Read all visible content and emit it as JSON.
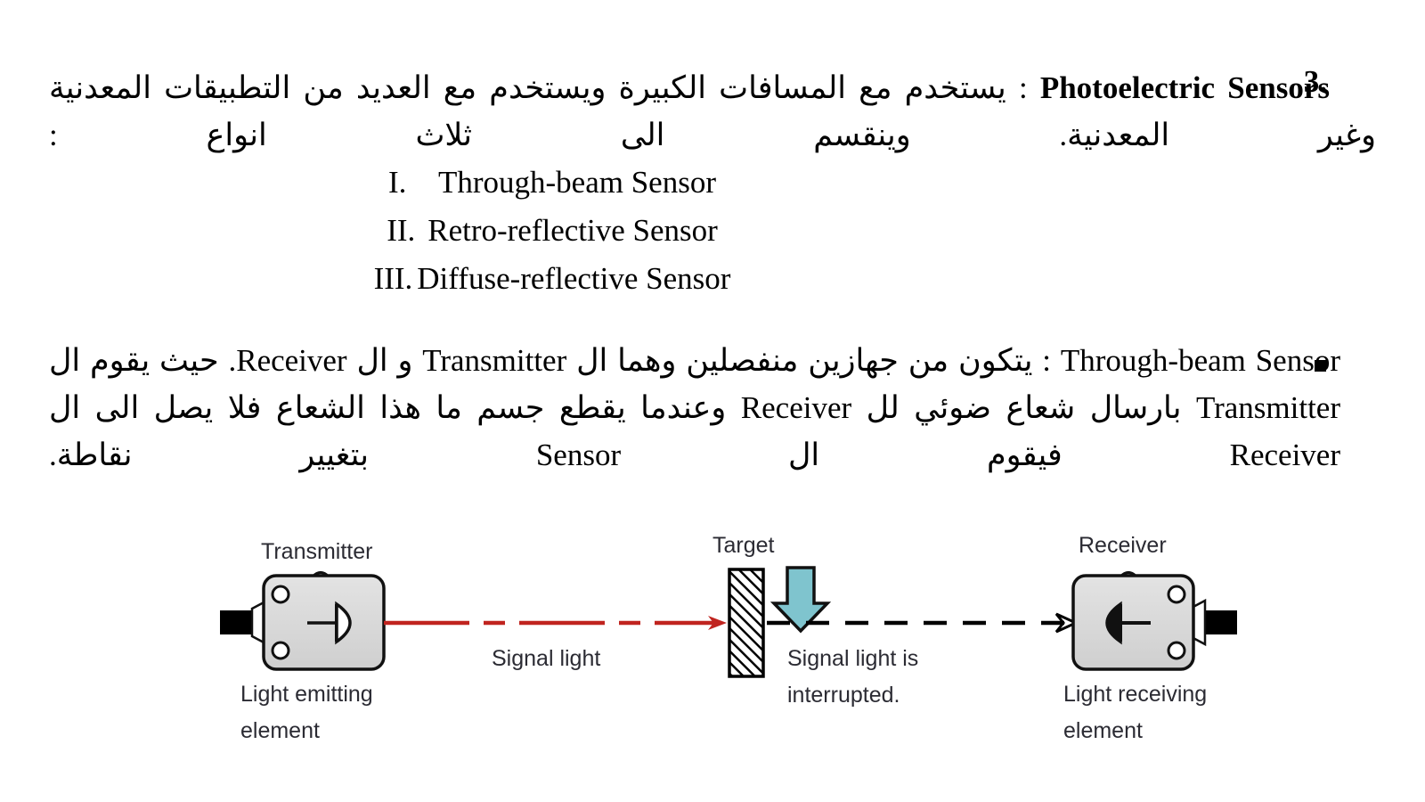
{
  "document": {
    "section_number": "3.",
    "section_title_en": "Photoelectric Sensors",
    "section_body_ar": " : يستخدم مع المسافات الكبيرة ويستخدم مع العديد من التطبيقات المعدنية وغير المعدنية. وينقسم الى ثلاث انواع :",
    "types_list": [
      {
        "numeral": "I.",
        "label": "Through-beam Sensor"
      },
      {
        "numeral": "II.",
        "label": "Retro-reflective Sensor"
      },
      {
        "numeral": "III.",
        "label": "Diffuse-reflective Sensor"
      }
    ],
    "bullet_marker": "square",
    "bullet_title_en": "Through-beam Sensor",
    "bullet_line1_ar": " : يتكون من جهازين منفصلين وهما ال ",
    "bullet_word_transmitter": "Transmitter",
    "bullet_line1b_ar": " و ال ",
    "bullet_word_receiver": "Receiver",
    "bullet_line2a_ar": ". حيث يقوم ال ",
    "bullet_line2b_ar": " بارسال شعاع ضوئي لل ",
    "bullet_line2c_ar": " وعندما يقطع جسم ما هذا الشعاع فلا يصل الى ال ",
    "bullet_line3a_ar": " فيقوم ال ",
    "bullet_word_sensor": "Sensor",
    "bullet_line3b_ar": " بتغيير نقاطة."
  },
  "diagram": {
    "transmitter": {
      "title": "Transmitter",
      "caption_line1": "Light emitting",
      "caption_line2": "element"
    },
    "receiver": {
      "title": "Receiver",
      "caption_line1": "Light receiving",
      "caption_line2": "element"
    },
    "target": {
      "title": "Target"
    },
    "signal_light_label": "Signal light",
    "interrupted_label_line1": "Signal light is",
    "interrupted_label_line2": "interrupted.",
    "colors": {
      "signal_beam": "#c0241f",
      "blocked_beam": "#000000",
      "arrow_fill": "#7fc4ce",
      "housing_fill": "#d9d9d9",
      "label_text": "#2b2b33",
      "cable": "#000000"
    }
  }
}
